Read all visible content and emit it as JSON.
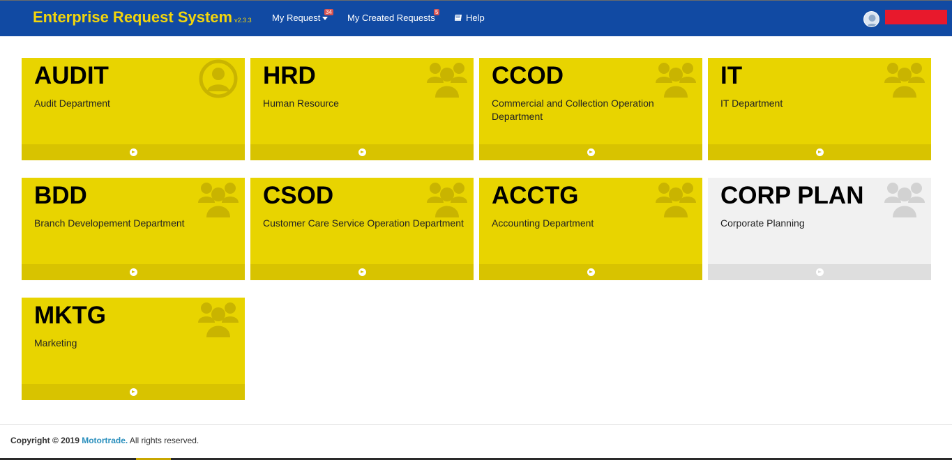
{
  "header": {
    "brand": "Enterprise Request System",
    "version": "v2.3.3",
    "nav": [
      {
        "label": "My Request",
        "badge": "34"
      },
      {
        "label": "My Created Requests",
        "badge": "5"
      },
      {
        "label": "Help"
      }
    ],
    "user_name_redacted": true
  },
  "tiles": [
    {
      "code": "AUDIT",
      "description": "Audit Department",
      "icon": "user-circle-icon",
      "state": "active"
    },
    {
      "code": "HRD",
      "description": "Human Resource",
      "icon": "users-icon",
      "state": "active"
    },
    {
      "code": "CCOD",
      "description": "Commercial and Collection Operation Department",
      "icon": "users-icon",
      "state": "active"
    },
    {
      "code": "IT",
      "description": "IT Department",
      "icon": "users-icon",
      "state": "active"
    },
    {
      "code": "BDD",
      "description": "Branch Developement Department",
      "icon": "users-icon",
      "state": "active"
    },
    {
      "code": "CSOD",
      "description": "Customer Care Service Operation Department",
      "icon": "users-icon",
      "state": "active"
    },
    {
      "code": "ACCTG",
      "description": "Accounting Department",
      "icon": "users-icon",
      "state": "active"
    },
    {
      "code": "CORP PLAN",
      "description": "Corporate Planning",
      "icon": "users-icon",
      "state": "disabled"
    },
    {
      "code": "MKTG",
      "description": "Marketing",
      "icon": "users-icon",
      "state": "active"
    }
  ],
  "footer": {
    "prefix": "Copyright © 2019",
    "company": "Motortrade.",
    "suffix": "All rights reserved."
  },
  "colors": {
    "navbar": "#114aa3",
    "brand": "#f2d50c",
    "tile_active": "#e8d400",
    "tile_footer": "#d8c300",
    "tile_disabled": "#f1f1f1",
    "link": "#2a8fbd"
  }
}
